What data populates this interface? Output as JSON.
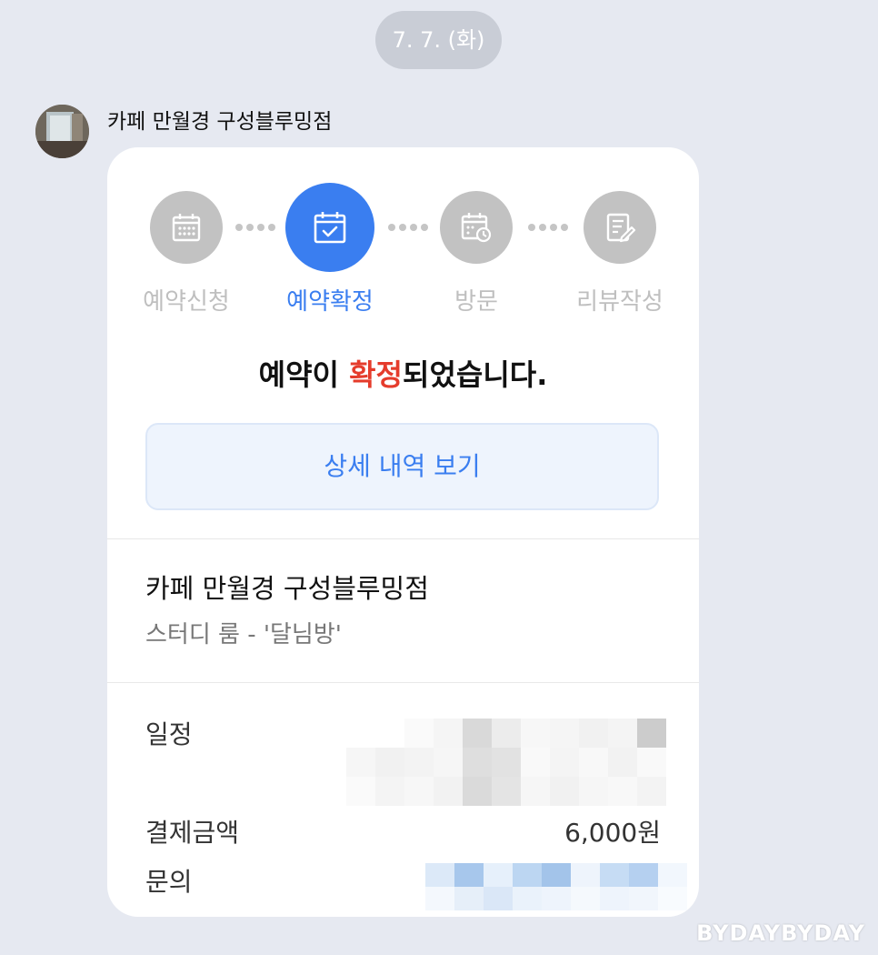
{
  "date_divider": "7. 7. (화)",
  "sender": {
    "name": "카페 만월경 구성블루밍점"
  },
  "steps": [
    {
      "label": "예약신청",
      "icon": "calendar-grid-icon",
      "state": "inactive"
    },
    {
      "label": "예약확정",
      "icon": "calendar-check-icon",
      "state": "active"
    },
    {
      "label": "방문",
      "icon": "calendar-clock-icon",
      "state": "inactive"
    },
    {
      "label": "리뷰작성",
      "icon": "edit-note-icon",
      "state": "inactive"
    }
  ],
  "confirmation": {
    "prefix": "예약이 ",
    "highlight": "확정",
    "suffix": "되었습니다."
  },
  "detail_button_label": "상세 내역 보기",
  "store": {
    "name": "카페 만월경 구성블루밍점",
    "room": "스터디 룸 - '달님방'"
  },
  "info": {
    "schedule_label": "일정",
    "payment_label": "결제금액",
    "payment_value": "6,000원",
    "contact_label": "문의"
  },
  "watermark": "BYDAYBYDAY",
  "colors": {
    "accent": "#3a7ef0",
    "highlight": "#e53c2c",
    "background": "#e6e9f1",
    "inactive_step": "#c2c2c2"
  }
}
